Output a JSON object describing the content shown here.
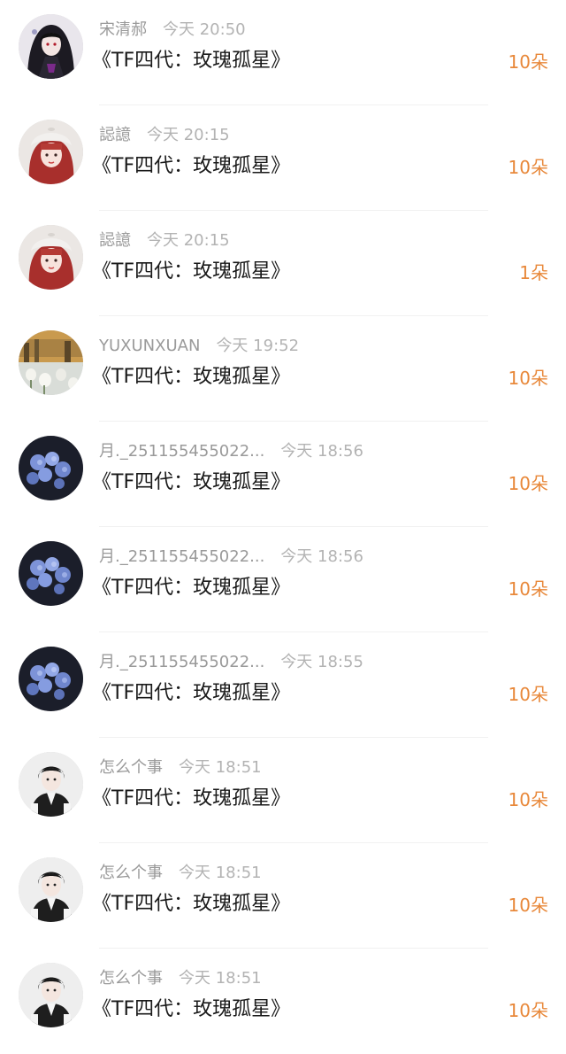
{
  "colors": {
    "name_gray": "#9a9a9a",
    "time_gray": "#b3b3b3",
    "title": "#1a1a1a",
    "amount_orange": "#e8883a",
    "divider": "#f1f1f1"
  },
  "gifts": [
    {
      "user": "宋清郝",
      "time": "今天 20:50",
      "title": "《TF四代：玫瑰孤星》",
      "amount": "10朵",
      "avatar": "gothic-girl-avatar"
    },
    {
      "user": "誋譩",
      "time": "今天 20:15",
      "title": "《TF四代：玫瑰孤星》",
      "amount": "10朵",
      "avatar": "red-hair-girl-avatar"
    },
    {
      "user": "誋譩",
      "time": "今天 20:15",
      "title": "《TF四代：玫瑰孤星》",
      "amount": "1朵",
      "avatar": "red-hair-girl-avatar"
    },
    {
      "user": "YUXUNXUAN",
      "time": "今天 19:52",
      "title": "《TF四代：玫瑰孤星》",
      "amount": "10朵",
      "avatar": "tulips-sunset-avatar"
    },
    {
      "user": "月._251155455022...",
      "time": "今天 18:56",
      "title": "《TF四代：玫瑰孤星》",
      "amount": "10朵",
      "avatar": "blue-roses-avatar"
    },
    {
      "user": "月._251155455022...",
      "time": "今天 18:56",
      "title": "《TF四代：玫瑰孤星》",
      "amount": "10朵",
      "avatar": "blue-roses-avatar"
    },
    {
      "user": "月._251155455022...",
      "time": "今天 18:55",
      "title": "《TF四代：玫瑰孤星》",
      "amount": "10朵",
      "avatar": "blue-roses-avatar"
    },
    {
      "user": "怎么个事",
      "time": "今天 18:51",
      "title": "《TF四代：玫瑰孤星》",
      "amount": "10朵",
      "avatar": "boy-vest-avatar"
    },
    {
      "user": "怎么个事",
      "time": "今天 18:51",
      "title": "《TF四代：玫瑰孤星》",
      "amount": "10朵",
      "avatar": "boy-vest-avatar"
    },
    {
      "user": "怎么个事",
      "time": "今天 18:51",
      "title": "《TF四代：玫瑰孤星》",
      "amount": "10朵",
      "avatar": "boy-vest-avatar"
    }
  ]
}
